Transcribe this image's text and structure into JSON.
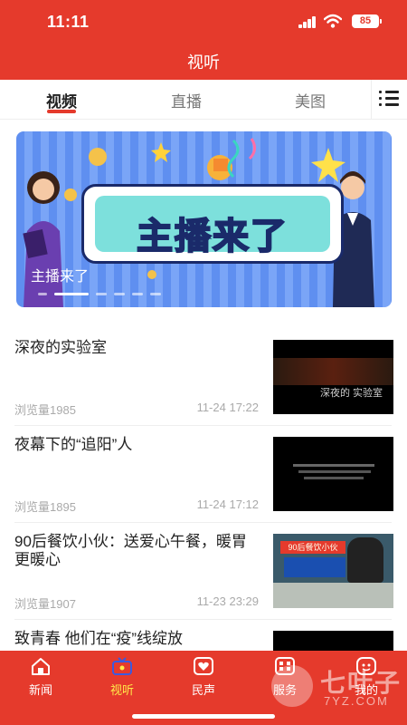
{
  "status_bar": {
    "time": "11:11",
    "battery": "85"
  },
  "header": {
    "title": "视听"
  },
  "tabs": [
    {
      "label": "视频",
      "active": true
    },
    {
      "label": "直播",
      "active": false
    },
    {
      "label": "美图",
      "active": false
    }
  ],
  "banner": {
    "board_text": "主播来了",
    "caption": "主播来了",
    "slide_count": 6,
    "active_slide": 2
  },
  "news": [
    {
      "title": "深夜的实验室",
      "views": "浏览量1985",
      "time": "11-24 17:22",
      "thumb_text": "深夜的 实验室"
    },
    {
      "title": "夜幕下的“追阳”人",
      "views": "浏览量1895",
      "time": "11-24 17:12",
      "thumb_text": ""
    },
    {
      "title": "90后餐饮小伙：送爱心午餐，暖胃更暖心",
      "views": "浏览量1907",
      "time": "11-23 23:29",
      "thumb_text": "90后餐饮小伙"
    },
    {
      "title": "致青春 他们在“疫”线绽放",
      "views": "",
      "time": "",
      "thumb_text": ""
    }
  ],
  "bottom_nav": [
    {
      "label": "新闻",
      "icon": "house-icon",
      "active": false
    },
    {
      "label": "视听",
      "icon": "tv-icon",
      "active": true
    },
    {
      "label": "民声",
      "icon": "heart-icon",
      "active": false
    },
    {
      "label": "服务",
      "icon": "grid-icon",
      "active": false
    },
    {
      "label": "我的",
      "icon": "person-icon",
      "active": false
    }
  ],
  "watermark": {
    "text": "七叶子",
    "sub": "7YZ.COM"
  },
  "colors": {
    "brand_red": "#e53a2c",
    "active_nav_label": "#ffe94a"
  }
}
